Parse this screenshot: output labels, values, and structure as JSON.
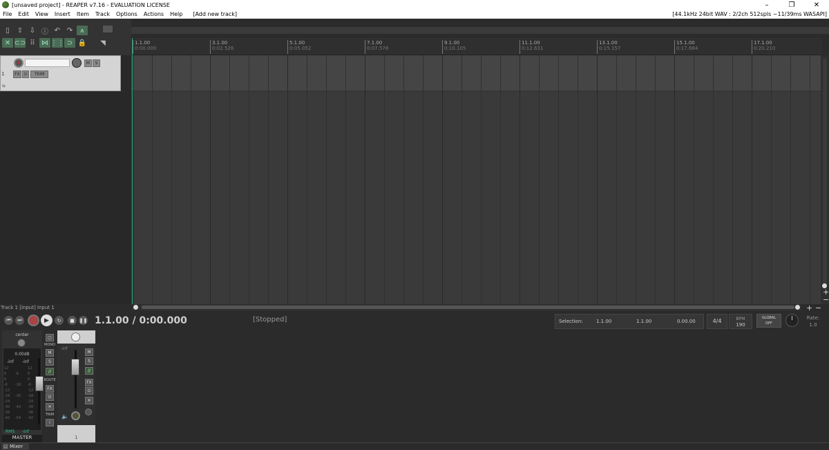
{
  "window": {
    "title": "[unsaved project] - REAPER v7.16 - EVALUATION LICENSE",
    "minimize": "–",
    "restore": "❐",
    "close": "✕"
  },
  "menu": {
    "items": [
      "File",
      "Edit",
      "View",
      "Insert",
      "Item",
      "Track",
      "Options",
      "Actions",
      "Help",
      "[Add new track]"
    ],
    "status": "[44.1kHz 24bit WAV : 2/2ch 512spls ~11/39ms WASAPI]"
  },
  "ruler": {
    "marks": [
      {
        "bar": "1.1.00",
        "time": "0:00.000"
      },
      {
        "bar": "3.1.00",
        "time": "0:02.526"
      },
      {
        "bar": "5.1.00",
        "time": "0:05.052"
      },
      {
        "bar": "7.1.00",
        "time": "0:07.578"
      },
      {
        "bar": "9.1.00",
        "time": "0:10.105"
      },
      {
        "bar": "11.1.00",
        "time": "0:12.631"
      },
      {
        "bar": "13.1.00",
        "time": "0:15.157"
      },
      {
        "bar": "15.1.00",
        "time": "0:17.684"
      },
      {
        "bar": "17.1.00",
        "time": "0:20.210"
      }
    ]
  },
  "track1": {
    "number": "1",
    "fx_label": "FX",
    "mute_label": "M",
    "solo_label": "S",
    "trim_label": "TRIM"
  },
  "status": {
    "track_input": "Track 1 [input] Input 1"
  },
  "transport": {
    "position": "1.1.00 / 0:00.000",
    "state": "[Stopped]",
    "selection_label": "Selection:",
    "sel_start": "1.1.00",
    "sel_end": "1.1.00",
    "sel_length": "0.00.00",
    "time_signature": "4/4",
    "bpm_label": "BPM",
    "bpm_value": "190",
    "global_label": "GLOBAL",
    "global_state": "OFF",
    "rate_label": "Rate:",
    "rate_value": "1.0"
  },
  "mixer": {
    "master": {
      "pan": "center",
      "db": "0.00dB",
      "peak_left": "-inf",
      "peak_right": "-inf",
      "rms_label": "RMS",
      "rms_value": "-inf",
      "name": "MASTER",
      "mono_label": "MONO",
      "mute_label": "M",
      "solo_label": "S",
      "route_label": "ROUTE",
      "fx_label": "FX",
      "trim_label": "TRIM",
      "info_label": "i",
      "scale_left": [
        "12",
        "6",
        "0",
        "-6",
        "-12",
        "-18",
        "-24",
        "-30",
        "-36",
        "-42"
      ],
      "scale_mid": [
        "-6",
        "-18",
        "-30",
        "-42",
        "-54"
      ],
      "scale_right": [
        "12",
        "6",
        "0",
        "-6",
        "-12",
        "-18",
        "-24",
        "-30",
        "-36",
        "-42"
      ]
    },
    "track": {
      "level": "-inf",
      "mute_label": "M",
      "solo_label": "S",
      "fx_label": "FX",
      "number": "1"
    },
    "tab_label": "Mixer"
  }
}
